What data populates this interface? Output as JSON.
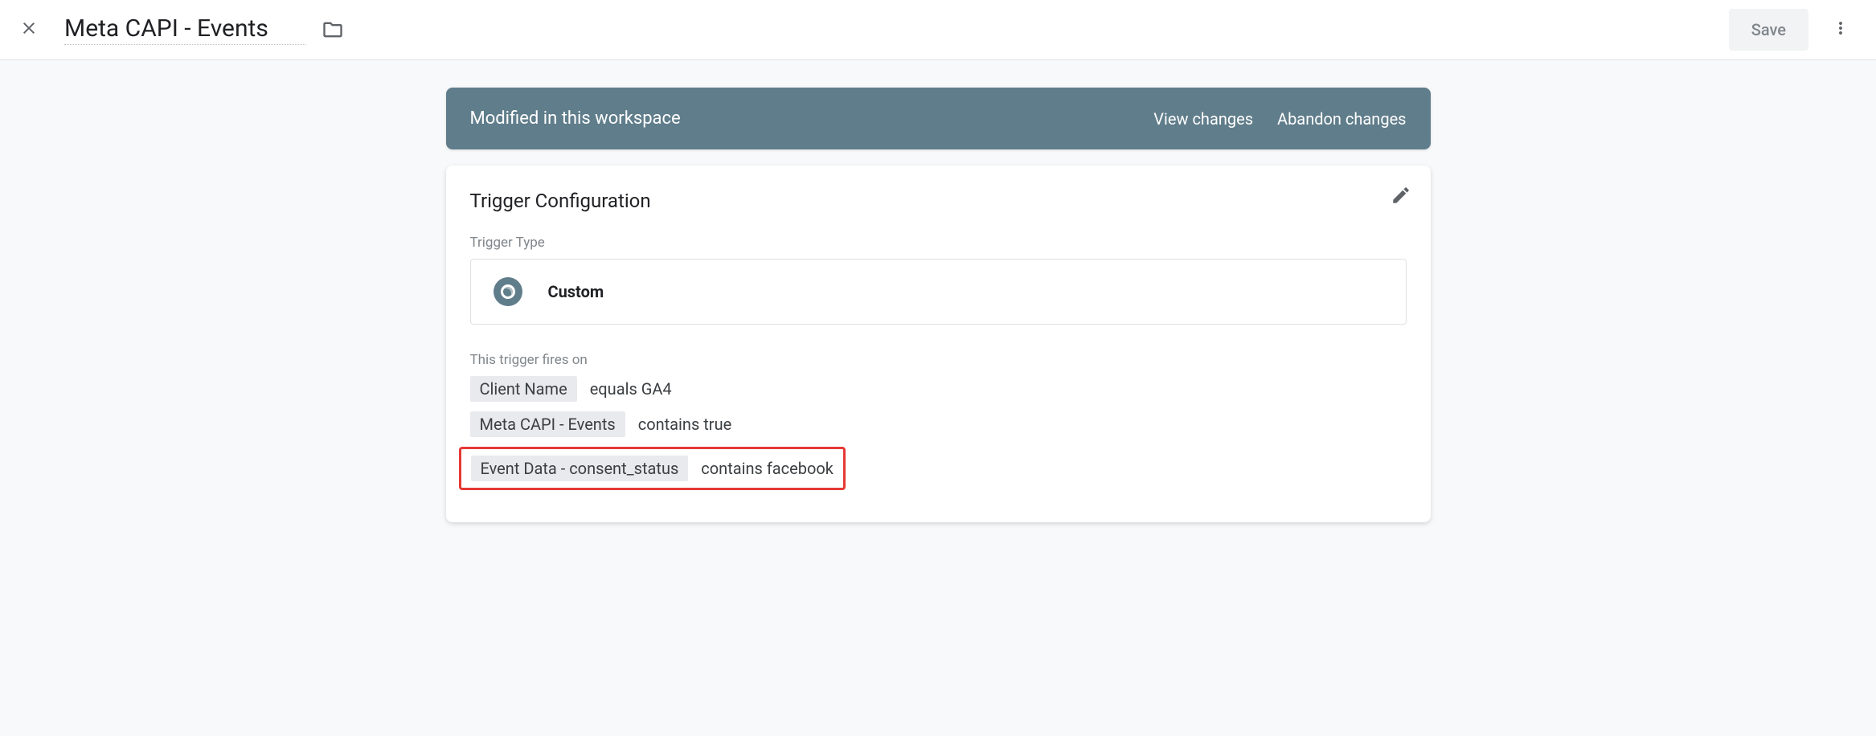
{
  "header": {
    "title": "Meta CAPI - Events",
    "save": "Save"
  },
  "banner": {
    "text": "Modified in this workspace",
    "view": "View changes",
    "abandon": "Abandon changes"
  },
  "card": {
    "title": "Trigger Configuration",
    "trigger_type_label": "Trigger Type",
    "trigger_type_value": "Custom",
    "fires_on_label": "This trigger fires on",
    "conditions": [
      {
        "variable": "Client Name",
        "text": "equals GA4",
        "highlight": false
      },
      {
        "variable": "Meta CAPI - Events",
        "text": "contains true",
        "highlight": false
      },
      {
        "variable": "Event Data - consent_status",
        "text": "contains facebook",
        "highlight": true
      }
    ]
  }
}
